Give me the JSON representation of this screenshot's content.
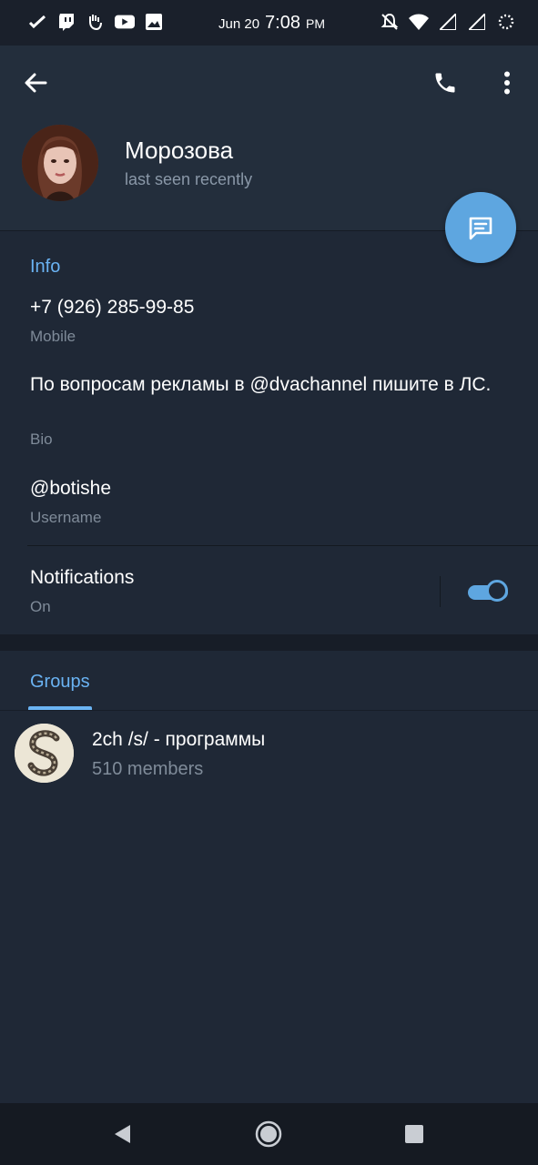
{
  "status_bar": {
    "date": "Jun 20",
    "time": "7:08",
    "ampm": "PM",
    "left_icons": [
      "missed-call-icon",
      "twitch-icon",
      "gesture-icon",
      "youtube-icon",
      "image-icon"
    ],
    "right_icons": [
      "notifications-off-icon",
      "wifi-icon",
      "signal-icon",
      "signal-icon",
      "loading-icon"
    ]
  },
  "header": {
    "name": "Морозова",
    "status": "last seen recently",
    "actions": [
      "back-icon",
      "phone-icon",
      "more-vert-icon"
    ]
  },
  "fab": {
    "icon": "message-icon"
  },
  "info": {
    "title": "Info",
    "phone": {
      "value": "+7 (926) 285-99-85",
      "label": "Mobile"
    },
    "bio": {
      "value": "По вопросам рекламы в @dvachannel пишите в ЛС.",
      "label": "Bio"
    },
    "username": {
      "value": "@botishe",
      "label": "Username"
    },
    "notifications": {
      "value": "Notifications",
      "label": "On",
      "enabled": true
    }
  },
  "groups": {
    "tab": "Groups",
    "items": [
      {
        "name": "2ch /s/ - программы",
        "members": "510 members"
      }
    ]
  },
  "nav_bar": [
    "back-triangle-icon",
    "home-circle-icon",
    "recents-square-icon"
  ],
  "colors": {
    "accent": "#6ab3f3",
    "fab": "#5ea6e0",
    "header_bg": "#232e3c",
    "content_bg": "#1f2836",
    "secondary_text": "#7f8b99"
  }
}
